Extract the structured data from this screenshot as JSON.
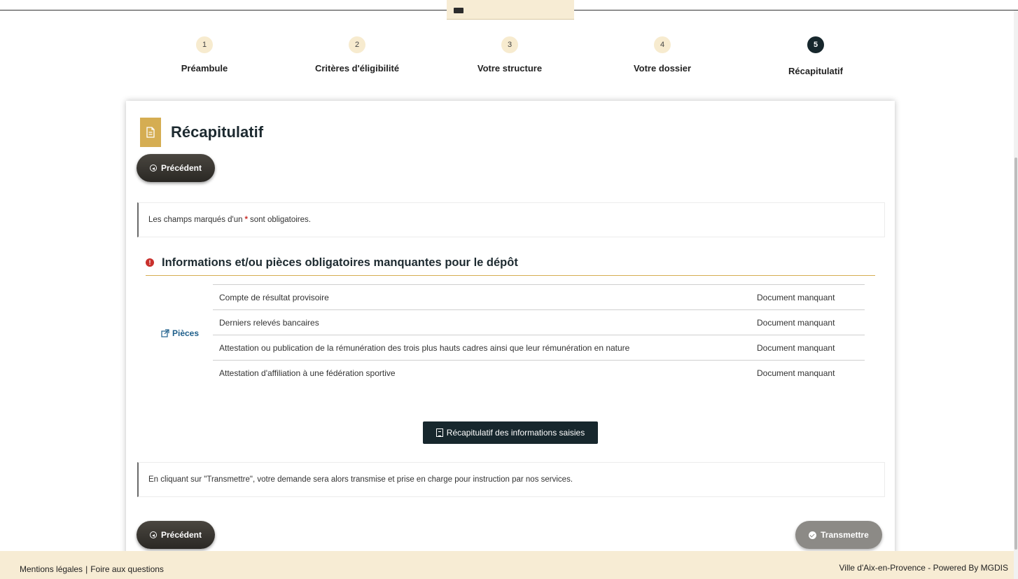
{
  "stepper": {
    "steps": [
      {
        "number": "1",
        "label": "Préambule"
      },
      {
        "number": "2",
        "label": "Critères d'éligibilité"
      },
      {
        "number": "3",
        "label": "Votre structure"
      },
      {
        "number": "4",
        "label": "Votre dossier"
      },
      {
        "number": "5",
        "label": "Récapitulatif"
      }
    ],
    "active_step": 5
  },
  "page": {
    "title": "Récapitulatif",
    "title_icon": "document-icon"
  },
  "buttons": {
    "previous_label": "Précédent",
    "summary_label": "Récapitulatif des informations saisies",
    "submit_label": "Transmettre"
  },
  "notes": {
    "required_prefix": "Les champs marqués d'un",
    "required_star": "*",
    "required_suffix": "sont obligatoires.",
    "transmit_info": "En cliquant sur \"Transmettre\", votre demande sera alors transmise et prise en charge pour instruction par nos services."
  },
  "missing": {
    "title": "Informations et/ou pièces obligatoires manquantes pour le dépôt",
    "group_label": "Pièces",
    "items": [
      {
        "name": "Compte de résultat provisoire",
        "status": "Document manquant"
      },
      {
        "name": "Derniers relevés bancaires",
        "status": "Document manquant"
      },
      {
        "name": "Attestation ou publication de la rémunération des trois plus hauts cadres ainsi que leur rémunération en nature",
        "status": "Document manquant"
      },
      {
        "name": "Attestation d'affiliation à une fédération sportive",
        "status": "Document manquant"
      }
    ]
  },
  "footer": {
    "legal": "Mentions légales",
    "separator": "|",
    "faq": "Foire aux questions",
    "credit": "Ville d'Aix-en-Provence - Powered By MGDIS"
  },
  "colors": {
    "accent": "#d5ad52",
    "dark": "#17272d",
    "alert": "#c9302c",
    "link": "#1f5f8b",
    "footer_bg": "#f7ecd4"
  }
}
